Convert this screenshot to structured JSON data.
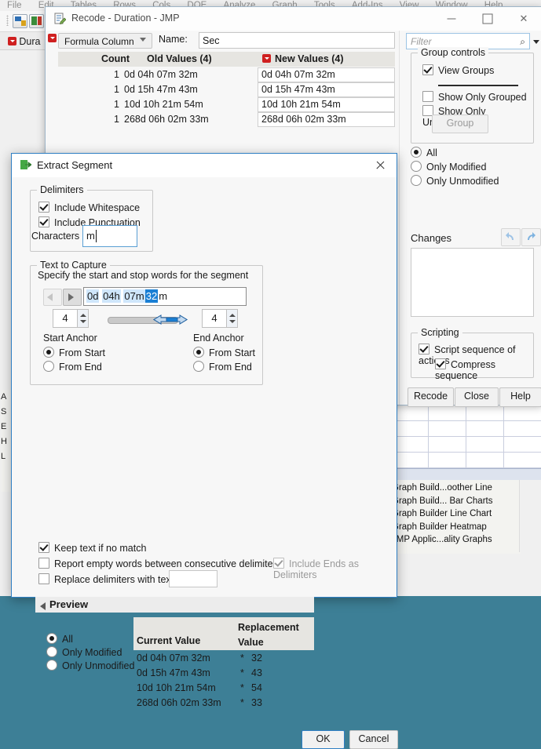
{
  "menubar": {
    "items": [
      "File",
      "Edit",
      "Tables",
      "Rows",
      "Cols",
      "DOE",
      "Analyze",
      "Graph",
      "Tools",
      "Add-Ins",
      "View",
      "Window",
      "Help"
    ]
  },
  "background": {
    "column_label": "Dura",
    "recent_items": [
      "Graph Build...oother Line",
      "Graph Build... Bar Charts",
      "Graph Builder Line Chart",
      "Graph Builder Heatmap",
      "JMP Applic...ality Graphs"
    ],
    "left_strip": [
      "A",
      "S",
      "E",
      "H",
      "L"
    ]
  },
  "recode": {
    "title": "Recode - Duration - JMP",
    "window_buttons": {
      "minimize": "–",
      "maximize": "□",
      "close": "✕"
    },
    "column_type": "Formula Column",
    "name_label": "Name:",
    "name_value": "Sec",
    "table": {
      "headers": {
        "count": "Count",
        "old": "Old Values (4)",
        "new": "New Values (4)"
      },
      "rows": [
        {
          "count": "1",
          "old": "0d 04h 07m 32m",
          "new": "0d 04h 07m 32m"
        },
        {
          "count": "1",
          "old": "0d 15h 47m 43m",
          "new": "0d 15h 47m 43m"
        },
        {
          "count": "1",
          "old": "10d 10h 21m 54m",
          "new": "10d 10h 21m 54m"
        },
        {
          "count": "1",
          "old": "268d 06h 02m 33m",
          "new": "268d 06h 02m 33m"
        }
      ]
    },
    "filter_placeholder": "Filter",
    "group_controls": {
      "legend": "Group controls",
      "view_groups": "View Groups",
      "show_only_grouped": "Show Only Grouped",
      "show_only_ungrouped": "Show Only Ungrouped",
      "group_button": "Group"
    },
    "view_filter": {
      "all": "All",
      "only_modified": "Only Modified",
      "only_unmodified": "Only Unmodified"
    },
    "changes_label": "Changes",
    "scripting": {
      "legend": "Scripting",
      "script_sequence": "Script sequence of actions",
      "compress_sequence": "Compress sequence"
    },
    "buttons": {
      "recode": "Recode",
      "close": "Close",
      "help": "Help"
    }
  },
  "extract": {
    "title": "Extract Segment",
    "delimiters": {
      "legend": "Delimiters",
      "include_whitespace": "Include Whitespace",
      "include_punctuation": "Include Punctuation",
      "characters_label": "Characters",
      "characters_value": "m"
    },
    "text_to_capture": {
      "legend": "Text to Capture",
      "description": "Specify the start and stop words for the segment",
      "segment_tokens": [
        {
          "text": "0d",
          "state": "lite"
        },
        {
          "text": "04h",
          "state": "lite"
        },
        {
          "text": "07m",
          "state": "lite"
        },
        {
          "text": "32",
          "state": "strong"
        },
        {
          "text": "m",
          "state": "none"
        }
      ],
      "start_value": "4",
      "end_value": "4",
      "start_anchor_label": "Start Anchor",
      "end_anchor_label": "End Anchor",
      "from_start": "From Start",
      "from_end": "From End"
    },
    "options": {
      "keep_text_if_no_match": "Keep text if no match",
      "report_empty_words": "Report empty words between consecutive delimiters",
      "include_ends_as_delimiters": "Include Ends as Delimiters",
      "replace_delimiters_with_text": "Replace delimiters with text",
      "replace_value": ""
    },
    "preview": {
      "title": "Preview",
      "filters": {
        "all": "All",
        "only_modified": "Only Modified",
        "only_unmodified": "Only Unmodified"
      },
      "headers": {
        "current": "Current Value",
        "replacement": "Replacement Value"
      },
      "rows": [
        {
          "current": "0d 04h 07m 32m",
          "star": "*",
          "replacement": "32"
        },
        {
          "current": "0d 15h 47m 43m",
          "star": "*",
          "replacement": "43"
        },
        {
          "current": "10d 10h 21m 54m",
          "star": "*",
          "replacement": "54"
        },
        {
          "current": "268d 06h 02m 33m",
          "star": "*",
          "replacement": "33"
        }
      ]
    },
    "buttons": {
      "ok": "OK",
      "cancel": "Cancel"
    }
  }
}
